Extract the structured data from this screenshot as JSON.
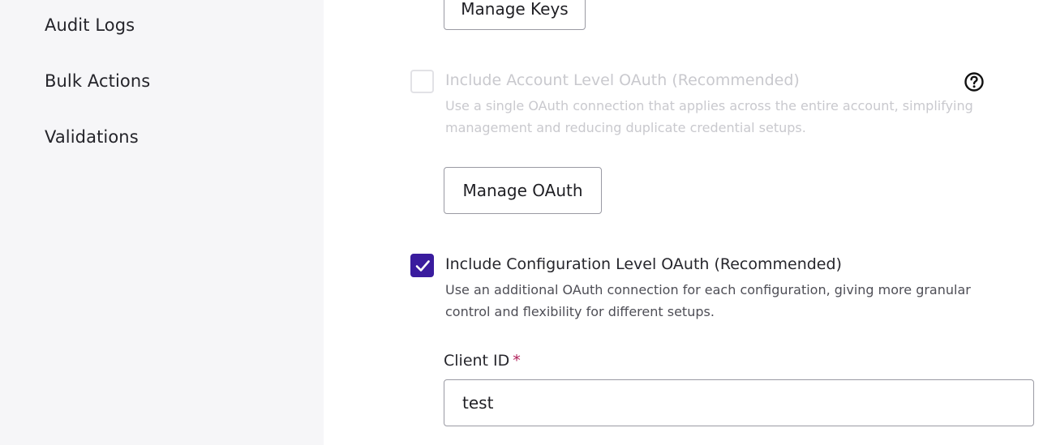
{
  "sidebar": {
    "items": [
      {
        "label": "Audit Logs"
      },
      {
        "label": "Bulk Actions"
      },
      {
        "label": "Validations"
      }
    ]
  },
  "keys": {
    "manage_label": "Manage Keys"
  },
  "account_oauth": {
    "title": "Include Account Level OAuth (Recommended)",
    "description": "Use a single OAuth connection that applies across the entire account, simplifying management and reducing duplicate credential setups.",
    "checked": false,
    "disabled": true,
    "manage_label": "Manage OAuth",
    "help_icon": "help-circle-icon"
  },
  "config_oauth": {
    "title": "Include Configuration Level OAuth (Recommended)",
    "description": "Use an additional OAuth connection for each configuration, giving more granular control and flexibility for different setups.",
    "checked": true
  },
  "client_id": {
    "label": "Client ID",
    "required_mark": "*",
    "value": "test"
  },
  "colors": {
    "accent": "#3a1c9e",
    "required": "#b0205a",
    "sidebar_bg": "#f6f6f8",
    "disabled_text": "#c9c9ce"
  }
}
